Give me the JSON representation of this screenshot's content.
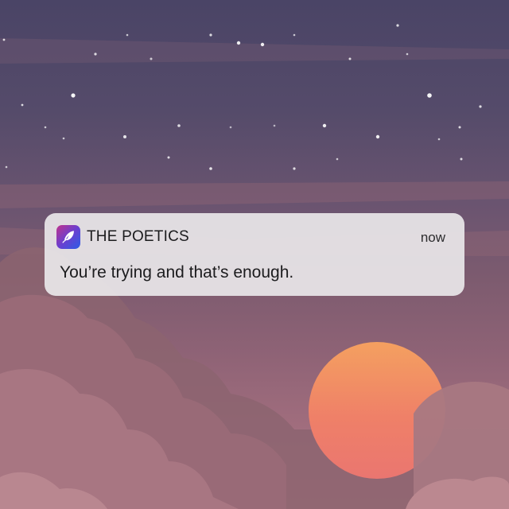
{
  "notification": {
    "app_icon": "quill-feather-icon",
    "app_name": "THE POETICS",
    "timestamp": "now",
    "message": "You’re trying and that’s enough."
  },
  "colors": {
    "sky_top": "#4a4466",
    "sky_bottom": "#b07882",
    "sun": "#ef8068",
    "notification_bg": "#e8e6e8",
    "app_icon_gradient": [
      "#c0338c",
      "#6a3fd0",
      "#2b5ce6"
    ]
  }
}
